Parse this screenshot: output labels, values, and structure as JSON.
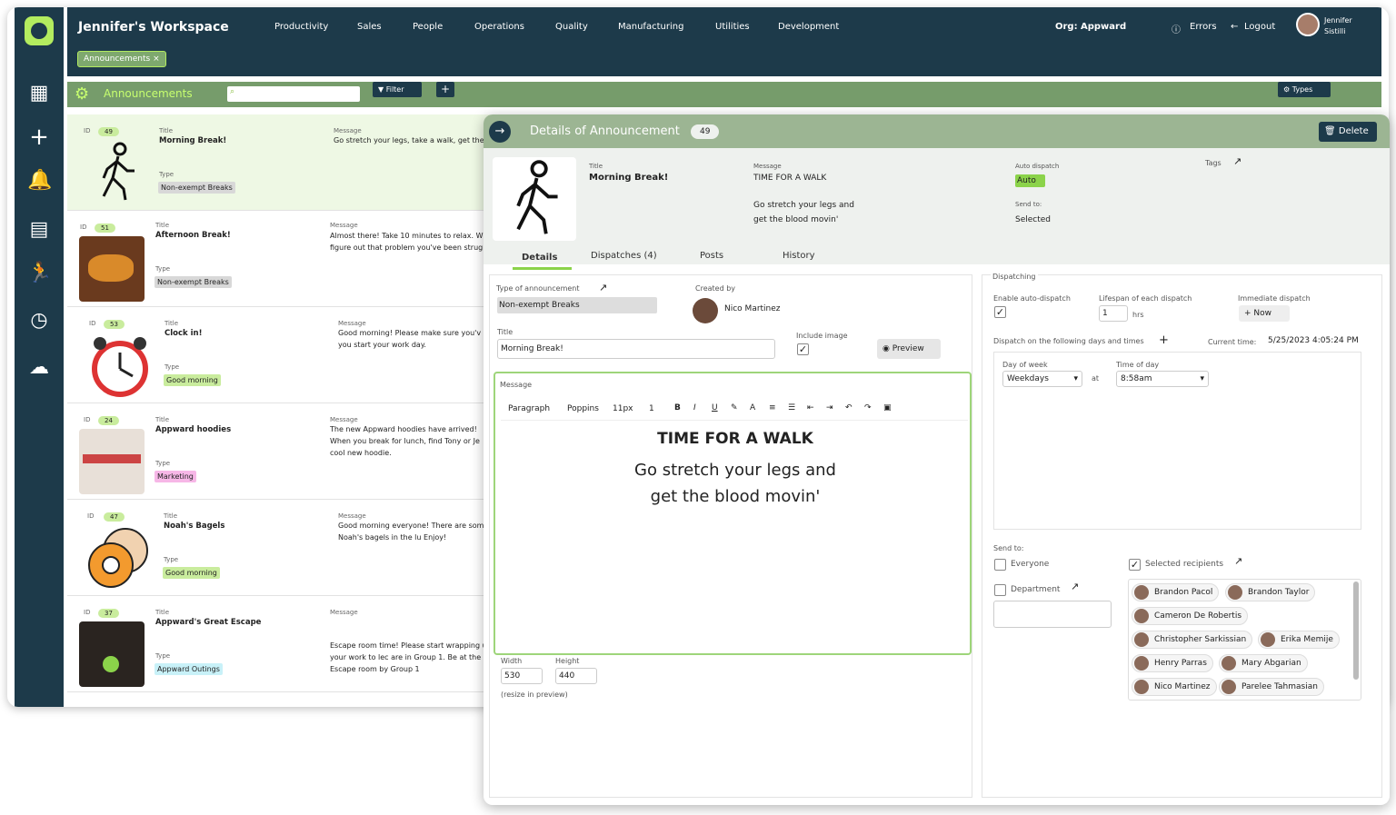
{
  "app": {
    "workspace": "Jennifer's Workspace",
    "menu": [
      "Productivity",
      "Sales",
      "People",
      "Operations",
      "Quality",
      "Manufacturing",
      "Utilities",
      "Development"
    ],
    "org_label": "Org:",
    "org_name": "Appward",
    "errors": "Errors",
    "logout": "Logout",
    "user_first": "Jennifer",
    "user_last": "Sistilli"
  },
  "tab_chip": {
    "label": "Announcements",
    "close": "×"
  },
  "toolbar": {
    "title": "Announcements",
    "filter": "Filter",
    "add": "+",
    "types": "Types"
  },
  "list": {
    "labels": {
      "id": "ID",
      "title": "Title",
      "type": "Type",
      "message": "Message"
    },
    "rows": [
      {
        "id": "49",
        "title": "Morning Break!",
        "type": "Non-exempt Breaks",
        "message": "Go stretch your legs, take a walk, get the"
      },
      {
        "id": "51",
        "title": "Afternoon Break!",
        "type": "Non-exempt Breaks",
        "message": "Almost there! Take 10 minutes to relax. W figure out that problem you've been strug"
      },
      {
        "id": "53",
        "title": "Clock in!",
        "type": "Good morning",
        "message": "Good morning! Please make sure you'v you start your work day."
      },
      {
        "id": "24",
        "title": "Appward hoodies",
        "type": "Marketing",
        "message": "The new Appward hoodies have arrived! When you break for lunch, find Tony or Je cool new hoodie."
      },
      {
        "id": "47",
        "title": "Noah's Bagels",
        "type": "Good morning",
        "message": "Good morning everyone! There are some Noah's bagels in the lu Enjoy!"
      },
      {
        "id": "37",
        "title": "Appward's Great Escape",
        "type": "Appward Outings",
        "message": "Escape room time! Please start wrapping up your work to lec are in Group 1. Be at the Escape room by Group 1"
      }
    ]
  },
  "detail": {
    "heading": "Details of Announcement",
    "id": "49",
    "delete": "Delete",
    "title_label": "Title",
    "title": "Morning Break!",
    "message_label": "Message",
    "message_line1": "TIME FOR A WALK",
    "message_line2": "Go stretch your legs and",
    "message_line3": "get the blood movin'",
    "auto_label": "Auto dispatch",
    "auto": "Auto",
    "sendto_label": "Send to:",
    "sendto": "Selected",
    "tags_label": "Tags",
    "tabs": [
      "Details",
      "Dispatches (4)",
      "Posts",
      "History"
    ],
    "type_label": "Type of announcement",
    "type_value": "Non-exempt Breaks",
    "created_label": "Created by",
    "created_by": "Nico Martinez",
    "title_field_label": "Title",
    "title_field": "Morning Break!",
    "include_image": "Include image",
    "preview": "Preview",
    "editor": {
      "label": "Message",
      "paragraph": "Paragraph",
      "font": "Poppins",
      "size": "11px",
      "line": "1",
      "heading": "TIME FOR A WALK",
      "body1": "Go stretch your legs and",
      "body2": "get the blood movin'"
    },
    "width_label": "Width",
    "width": "530",
    "height_label": "Height",
    "height": "440",
    "resize_hint": "(resize in preview)"
  },
  "dispatching": {
    "legend": "Dispatching",
    "enable_label": "Enable auto-dispatch",
    "lifespan_label": "Lifespan of each dispatch",
    "lifespan": "1",
    "hrs": "hrs",
    "immediate_label": "Immediate dispatch",
    "now": "Now",
    "days_label": "Dispatch on the following days and times",
    "current_label": "Current time:",
    "current_time": "5/25/2023 4:05:24 PM",
    "dow_label": "Day of week",
    "dow": "Weekdays",
    "at": "at",
    "tod_label": "Time of day",
    "tod": "8:58am",
    "sendto_label": "Send to:",
    "everyone": "Everyone",
    "department": "Department",
    "selected": "Selected recipients",
    "recipients": [
      "Brandon Pacol",
      "Brandon Taylor",
      "Cameron De Robertis",
      "Christopher Sarkissian",
      "Erika Memije",
      "Henry Parras",
      "Mary Abgarian",
      "Nico Martinez",
      "Parelee Tahmasian"
    ]
  },
  "colors": {
    "navy": "#1d3a4a",
    "lime": "#b3ec5f",
    "sage": "#769c6b"
  }
}
